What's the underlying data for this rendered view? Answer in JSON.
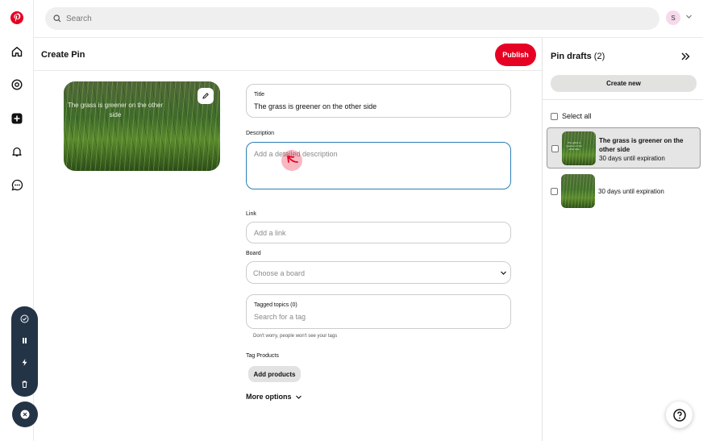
{
  "search": {
    "placeholder": "Search"
  },
  "account": {
    "initial": "S"
  },
  "header": {
    "title": "Create Pin",
    "publish_label": "Publish"
  },
  "preview": {
    "overlay_text": "The grass is greener on the other side"
  },
  "form": {
    "title": {
      "label": "Title",
      "value": "The grass is greener on the other side"
    },
    "description": {
      "label": "Description",
      "placeholder": "Add a detailed description"
    },
    "link": {
      "label": "Link",
      "placeholder": "Add a link"
    },
    "board": {
      "label": "Board",
      "placeholder": "Choose a board"
    },
    "tagged_topics": {
      "label": "Tagged topics (0)",
      "placeholder": "Search for a tag",
      "hint": "Don't worry, people won't see your tags"
    },
    "tag_products": {
      "label": "Tag Products",
      "button": "Add products"
    },
    "more_options": "More options"
  },
  "drafts": {
    "title": "Pin drafts",
    "count": "(2)",
    "create_new": "Create new",
    "select_all": "Select all",
    "items": [
      {
        "name": "The grass is greener on the other side",
        "expiry": "30 days until expiration",
        "thumb_text": "The grass is greener on the other side",
        "selected": true
      },
      {
        "name": "",
        "expiry": "30 days until expiration",
        "thumb_text": "",
        "selected": false
      }
    ]
  },
  "colors": {
    "brand": "#e60023",
    "focus": "#2b7fb5",
    "toolbar": "#243447"
  }
}
